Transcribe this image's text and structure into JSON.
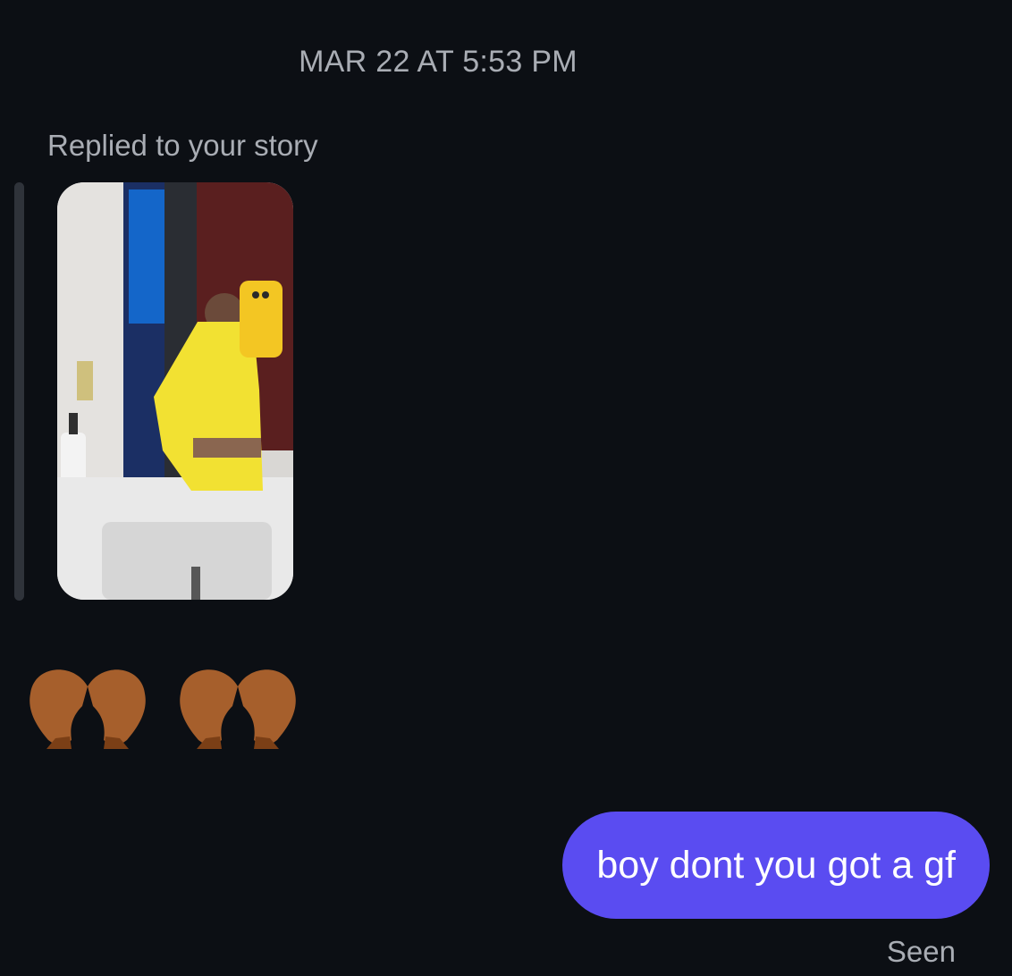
{
  "conversation": {
    "timestamp": "MAR 22 AT 5:53 PM",
    "story_reply": {
      "label": "Replied to your story",
      "image_icon": "story-photo-thumbnail"
    },
    "received_message": {
      "emoji": [
        "heart-hands-emoji",
        "heart-hands-emoji"
      ]
    },
    "sent_message": {
      "text": "boy dont you got a gf",
      "bubble_color": "#5a4cf1",
      "status": "Seen"
    }
  },
  "colors": {
    "background": "#0c0f14",
    "secondary_text": "#a9adb4"
  }
}
